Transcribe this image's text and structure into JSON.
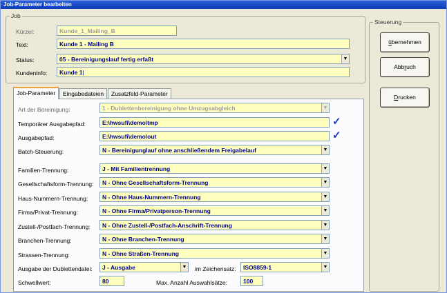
{
  "window": {
    "title": "Job-Parameter bearbeiten"
  },
  "job": {
    "legend": "Job",
    "kuerzel_label": "Kürzel:",
    "kuerzel_value": "Kunde_1_Mailing_B",
    "text_label": "Text:",
    "text_value": "Kunde 1 - Mailing B",
    "status_label": "Status:",
    "status_value": "05 - Bereinigungslauf fertig erfaßt",
    "kundeninfo_label": "Kundeninfo:",
    "kundeninfo_value": "Kunde 1"
  },
  "tabs": [
    "Job-Parameter",
    "Eingabedateien",
    "Zusatzfeld-Parameter"
  ],
  "params": {
    "art_label": "Art der Bereinigung:",
    "art_value": "1 - Dublettenbereinigung ohne Umzugsabgleich",
    "temp_label": "Temporärer Ausgabepfad:",
    "temp_value": "E:\\hwsufi\\demo\\tmp",
    "out_label": "Ausgabepfad:",
    "out_value": "E:\\hwsufi\\demo\\out",
    "check_glyph": "✓",
    "batch_label": "Batch-Steuerung:",
    "batch_value": "N - Bereinigunglauf ohne anschließendem Freigabelauf",
    "fam_label": "Familien-Trennung:",
    "fam_value": "J - Mit Familientrennung",
    "ges_label": "Gesellschaftsform-Trennung:",
    "ges_value": "N - Ohne Gesellschaftsform-Trennung",
    "haus_label": "Haus-Nummern-Trennung:",
    "haus_value": "N - Ohne Haus-Nummern-Trennung",
    "firma_label": "Firma/Privat-Trennung:",
    "firma_value": "N - Ohne Firma/Privatperson-Trennung",
    "zust_label": "Zustell-/Postfach-Trennung:",
    "zust_value": "N - Ohne Zustell-/Postfach-Anschrift-Trennung",
    "bran_label": "Branchen-Trennung:",
    "bran_value": "N - Ohne Branchen-Trennung",
    "stra_label": "Strassen-Trennung:",
    "stra_value": "N - Ohne Straßen-Trennung",
    "ausg_label": "Ausgabe der Dublettendatei:",
    "ausg_value": "J - Ausgabe",
    "zeich_label": "im Zeichensatz:",
    "zeich_value": "ISO8859-1",
    "schw_label": "Schwellwert:",
    "schw_value": "80",
    "max_label": "Max. Anzahl Auswahlsätze:",
    "max_value": "100"
  },
  "steuerung": {
    "legend": "Steuerung",
    "btn_uebernehmen_pre": "",
    "btn_uebernehmen_key": "ü",
    "btn_uebernehmen_post": "bernehmen",
    "btn_abbruch_pre": "Abb",
    "btn_abbruch_key": "r",
    "btn_abbruch_post": "uch",
    "btn_drucken_pre": "",
    "btn_drucken_key": "D",
    "btn_drucken_post": "rucken"
  },
  "icons": {
    "dropdown_arrow": "▼"
  }
}
